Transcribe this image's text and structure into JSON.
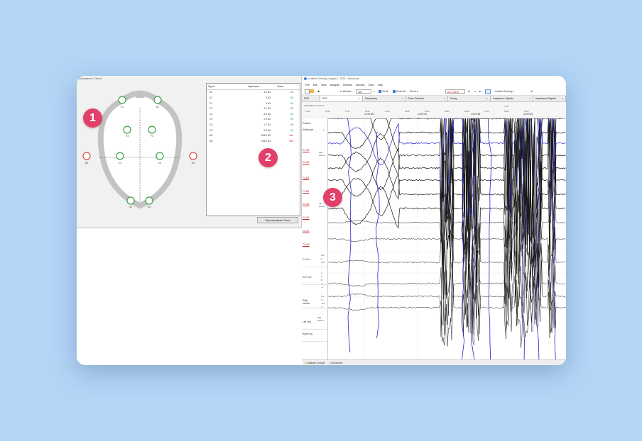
{
  "impedance_check": {
    "title": "Impedance Check",
    "electrodes": [
      "E2",
      "E1",
      "F4",
      "F3",
      "C4",
      "C3",
      "O1",
      "O2",
      "M1",
      "M2"
    ],
    "columns": [
      "Signal",
      "Impedance",
      "Status"
    ],
    "rows": [
      {
        "signal": "E2",
        "impedance": "4.3 kΩ",
        "status": "OK"
      },
      {
        "signal": "E1",
        "impedance": "3 kΩ",
        "status": "OK"
      },
      {
        "signal": "F4",
        "impedance": "3 kΩ",
        "status": "OK"
      },
      {
        "signal": "F3",
        "impedance": "4.1 kΩ",
        "status": "OK"
      },
      {
        "signal": "C4",
        "impedance": "4.3 kΩ",
        "status": "OK"
      },
      {
        "signal": "C3",
        "impedance": "2.9 kΩ",
        "status": "OK"
      },
      {
        "signal": "O1",
        "impedance": "1.7 kΩ",
        "status": "OK"
      },
      {
        "signal": "O2",
        "impedance": "2.9 kΩ",
        "status": "OK"
      },
      {
        "signal": "M1",
        "impedance": "184.8 kΩ",
        "status": "bad"
      },
      {
        "signal": "M2",
        "impedance": "135.8 kΩ",
        "status": "bad"
      }
    ],
    "stop_button": "Stop Impedance Check"
  },
  "app": {
    "title": "Untitled Tuesday, August 1, 2023 - Nomurnal",
    "menu": [
      "File",
      "Edit",
      "View",
      "Analysis",
      "Reports",
      "Devices",
      "Tools",
      "Help"
    ],
    "toolbar": {
      "window_label": "In Window",
      "window_value": "30s",
      "fit_all": "Fit All",
      "scale_all": "Scale All",
      "sheet": "Sheet",
      "montage": "A1s_pcD8",
      "scoring": "Untitled Scoring"
    },
    "tabs": [
      "PSG",
      "PSG",
      "Respiratory",
      "Pulse Oximeter",
      "Empty",
      "Impedance Signals",
      "Impedance Signals"
    ],
    "overview": {
      "date": "2023-08-01 14:35:57",
      "ticks_top": [
        "14:06",
        "15:00",
        "17:00",
        "19:00",
        "21:00",
        "23:00",
        "01:00",
        "03:00",
        "05:00",
        "07:00",
        "09:00",
        "11:00"
      ],
      "time_marks": [
        "14:07:35",
        "14:07:40",
        "14:07:45",
        "14:07:50"
      ],
      "zoom_value": "7.66"
    },
    "left_panel": {
      "position": "Position",
      "activity": "Activity g/s",
      "activity_value": "1",
      "channels": [
        "E1-M2",
        "E2-M2",
        "F4-M1",
        "F3-M2",
        "C4-M1",
        "C3-M2",
        "O2-M1",
        "O1-M2"
      ],
      "scale1": "120 µV/cm",
      "scale2": "75 µV/cm",
      "rows": [
        {
          "label": "F-3 mV",
          "values": [
            "0.0",
            "0",
            "-0.0"
          ]
        },
        {
          "label": "ECG mV",
          "values": [
            "4",
            "2",
            "0",
            "-2",
            "-4"
          ]
        },
        {
          "label": "Pleth unit/div",
          "values": [
            "0.0",
            "0",
            "-0.0",
            "-1"
          ]
        },
        {
          "label": "Left Leg",
          "values": [
            "180 µV/cm"
          ]
        },
        {
          "label": "Right Leg",
          "values": []
        }
      ]
    },
    "status": {
      "tab1": "Analysis Console",
      "tab2": "Bookmark"
    }
  },
  "markers": [
    "1",
    "2",
    "3"
  ],
  "colors": {
    "background": "#b3d5f6",
    "marker": "#e23f6b",
    "electrode_ok": "#3aa14a",
    "electrode_bad": "#e04848",
    "eeg_black": "#1a1a1a",
    "eeg_blue": "#2323c8"
  }
}
